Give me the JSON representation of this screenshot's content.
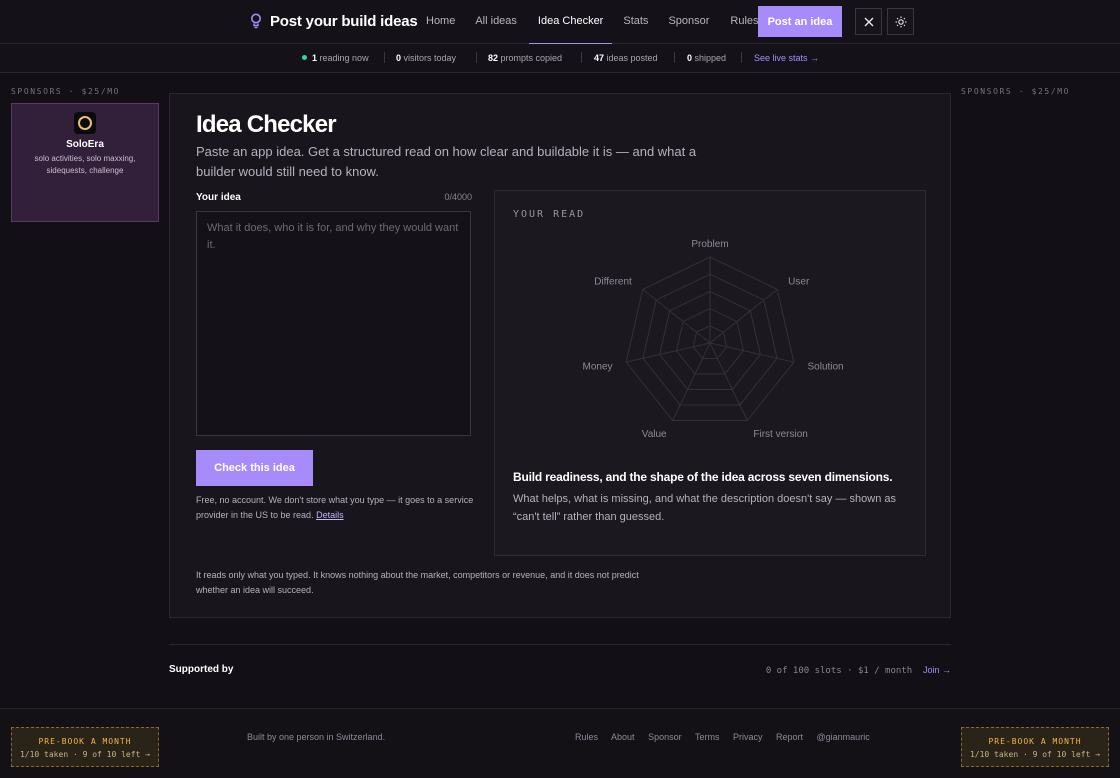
{
  "header": {
    "title": "Post your build ideas",
    "nav": [
      "Home",
      "All ideas",
      "Idea Checker",
      "Stats",
      "Sponsor",
      "Rules"
    ],
    "active_nav": "Idea Checker",
    "post_button": "Post an idea",
    "icons": [
      "lightbulb-icon",
      "x-logo-icon",
      "sun-icon"
    ]
  },
  "stats": {
    "reading_now": "1",
    "reading_now_label": "reading now",
    "visitors": "0",
    "visitors_label": "visitors today",
    "prompts": "82",
    "prompts_label": "prompts copied",
    "ideas": "47",
    "ideas_label": "ideas posted",
    "shipped": "0",
    "shipped_label": "shipped",
    "live_link": "See live stats →"
  },
  "rails": {
    "left_label": "SPONSORS · $25/MO",
    "right_label": "SPONSORS · $25/MO"
  },
  "sponsor": {
    "name": "SoloEra",
    "description": "solo activities, solo maxxing, sidequests, challenge"
  },
  "checker": {
    "title": "Idea Checker",
    "subtitle": "Paste an app idea. Get a structured read on how clear and buildable it is — and what a builder would still need to know.",
    "input_label": "Your idea",
    "char_count": "0/4000",
    "placeholder": "What it does, who it is for, and why they would want it.",
    "button": "Check this idea",
    "privacy_text": "Free, no account. We don't store what you type — it goes to a service provider in the US to be read.",
    "privacy_link": "Details",
    "disclaimer": "It reads only what you typed. It knows nothing about the market, competitors or revenue, and it does not predict whether an idea will succeed."
  },
  "read": {
    "title": "YOUR READ",
    "dimensions": [
      "Problem",
      "User",
      "Solution",
      "First version",
      "Value",
      "Money",
      "Different"
    ],
    "heading": "Build readiness, and the shape of the idea across seven dimensions.",
    "description": "What helps, what is missing, and what the description doesn't say — shown as “can't tell” rather than guessed."
  },
  "supported": {
    "label": "Supported by",
    "slots": "0 of 100 slots · $1 / month",
    "join": "Join →"
  },
  "footer": {
    "prebook_title": "PRE-BOOK A MONTH",
    "prebook_sub": "1/10 taken · 9 of 10 left →",
    "credit": "Built by one person in Switzerland.",
    "links": [
      "Rules",
      "About",
      "Sponsor",
      "Terms",
      "Privacy",
      "Report",
      "@gianmauric"
    ]
  },
  "colors": {
    "accent": "#a78bfa",
    "background": "#121016",
    "live_dot": "#34d399",
    "prebook": "#f5b547"
  }
}
